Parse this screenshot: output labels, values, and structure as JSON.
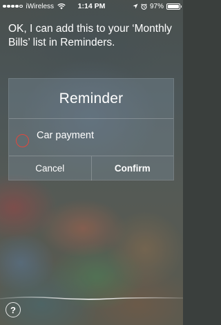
{
  "status_bar": {
    "carrier": "iWireless",
    "time": "1:14 PM",
    "battery": "97%",
    "battery_level": 0.97,
    "signal_bars": 4,
    "signal_max": 5
  },
  "siri": {
    "response": "OK, I can add this to your ‘Monthly Bills’ list in Reminders."
  },
  "reminder_card": {
    "title": "Reminder",
    "item": "Car payment",
    "circle_color": "#e3473d",
    "cancel_label": "Cancel",
    "confirm_label": "Confirm"
  },
  "help": {
    "label": "?"
  },
  "icons": {
    "wifi": "wifi-icon",
    "location": "location-arrow-icon",
    "alarm": "alarm-clock-icon",
    "battery": "battery-icon"
  }
}
